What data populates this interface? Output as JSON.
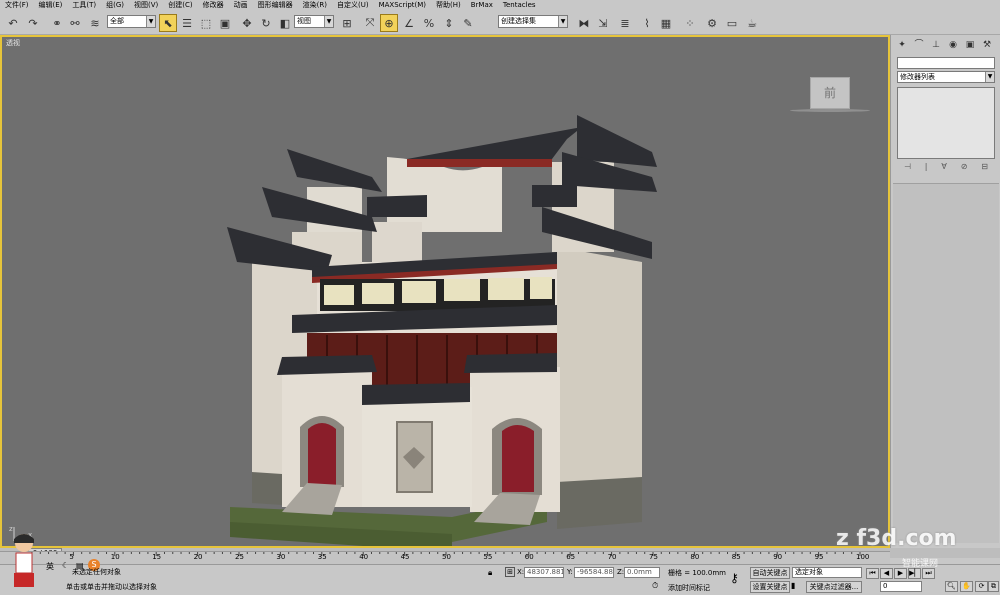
{
  "menu": [
    "文件(F)",
    "编辑(E)",
    "工具(T)",
    "组(G)",
    "视图(V)",
    "创建(C)",
    "修改器",
    "动画",
    "图形编辑器",
    "渲染(R)",
    "自定义(U)",
    "MAXScript(M)",
    "帮助(H)",
    "BrMax",
    "Tentacles"
  ],
  "toolbar": {
    "selection_filter": "全部",
    "ref_coord": "视图",
    "named_selection": "创建选择集",
    "icons": [
      "undo-icon",
      "redo-icon",
      "link-icon",
      "unlink-icon",
      "bind-spacewarp-icon",
      "select-icon",
      "select-by-name-icon",
      "rect-region-icon",
      "window-crossing-icon",
      "move-icon",
      "rotate-icon",
      "scale-icon",
      "pivot-icon",
      "manipulate-icon",
      "snap-icon",
      "angle-snap-icon",
      "percent-snap-icon",
      "spinner-snap-icon",
      "mirror-icon",
      "align-icon",
      "layer-icon",
      "curve-editor-icon",
      "schematic-icon",
      "material-editor-icon",
      "render-setup-icon",
      "rendered-frame-icon",
      "teapot-render-icon"
    ]
  },
  "viewport": {
    "label": "透视",
    "viewcube_label": "前",
    "bg_color": "#6f6f6f",
    "border_color": "#e6c43a"
  },
  "command_panel": {
    "tabs": [
      "create-icon",
      "modify-icon",
      "hierarchy-icon",
      "motion-icon",
      "display-icon",
      "utilities-icon"
    ],
    "modifier_list": "修改器列表"
  },
  "timeline": {
    "frame_display": "0 / 100",
    "ticks": [
      "0",
      "5",
      "10",
      "15",
      "20",
      "25",
      "30",
      "35",
      "40",
      "45",
      "50",
      "55",
      "60",
      "65",
      "70",
      "75",
      "80",
      "85",
      "90",
      "95",
      "100"
    ]
  },
  "status": {
    "ime": "英",
    "selection_text": "未选定任何对象",
    "prompt": "单击或单击并拖动以选择对象",
    "x_label": "X:",
    "x_value": "48307.881",
    "y_label": "Y:",
    "y_value": "-96584.88",
    "z_label": "Z:",
    "z_value": "0.0mm",
    "grid": "栅格 = 100.0mm",
    "auto_key": "自动关键点",
    "set_key": "设置关键点",
    "selected_filter": "选定对象",
    "key_filters": "关键点过滤器...",
    "add_time_tag": "添加时间标记",
    "frame_value": "0",
    "watermark": "z f3d.com",
    "watermark_sub": "智能课网"
  }
}
